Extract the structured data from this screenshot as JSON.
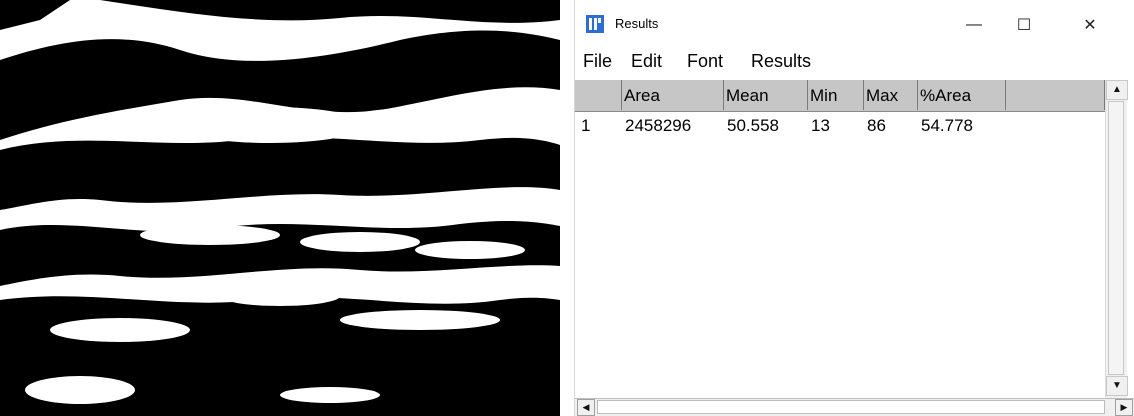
{
  "window": {
    "title": "Results",
    "icon": "imagej-icon",
    "controls": {
      "minimize": "—",
      "maximize": "☐",
      "close": "✕"
    }
  },
  "menu": [
    "File",
    "Edit",
    "Font",
    "Results"
  ],
  "table": {
    "columns": [
      "",
      "Area",
      "Mean",
      "Min",
      "Max",
      "%Area"
    ],
    "rows": [
      [
        "1",
        "2458296",
        "50.558",
        "13",
        "86",
        "54.778"
      ]
    ]
  },
  "scrollbars": {
    "up_arrow": "▲",
    "down_arrow": "▼",
    "left_arrow": "◀",
    "right_arrow": "▶"
  },
  "image": {
    "description_icon": "binary-threshold-image"
  }
}
